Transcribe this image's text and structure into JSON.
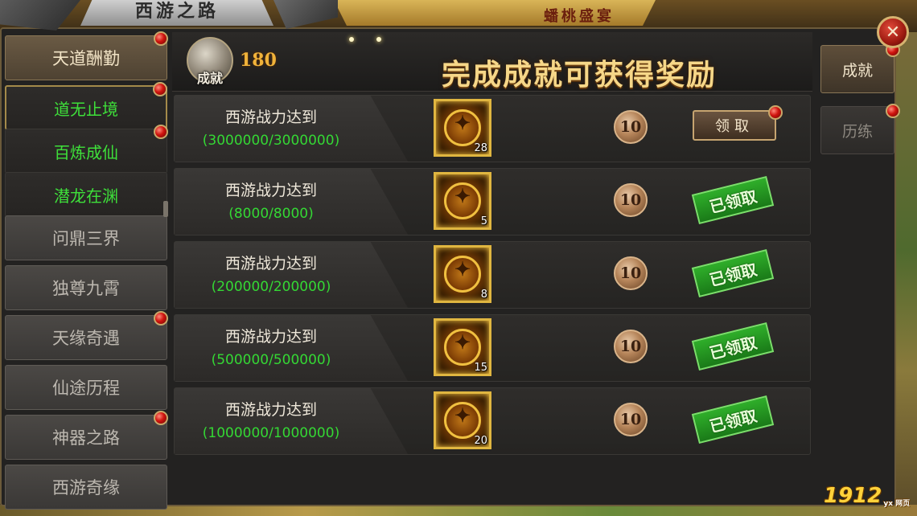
{
  "window": {
    "title": "西游之路",
    "top_banner": "蟠桃盛宴"
  },
  "menu": [
    {
      "label": "天道酬勤",
      "type": "head",
      "has_dot": true
    },
    {
      "label": "道无止境",
      "type": "sub",
      "active": true,
      "has_dot": true
    },
    {
      "label": "百炼成仙",
      "type": "sub",
      "has_dot": true
    },
    {
      "label": "潜龙在渊",
      "type": "sub",
      "has_dot": false
    },
    {
      "label": "问鼎三界",
      "type": "normal",
      "has_dot": false
    },
    {
      "label": "独尊九霄",
      "type": "normal",
      "has_dot": false
    },
    {
      "label": "天缘奇遇",
      "type": "normal",
      "has_dot": true
    },
    {
      "label": "仙途历程",
      "type": "normal",
      "has_dot": false
    },
    {
      "label": "神器之路",
      "type": "normal",
      "has_dot": true
    },
    {
      "label": "西游奇缘",
      "type": "normal",
      "has_dot": false
    }
  ],
  "header": {
    "badge_label": "成就",
    "score": "180",
    "headline": "完成成就可获得奖励"
  },
  "rows": [
    {
      "name": "西游战力达到",
      "progress": "(3000000/3000000)",
      "item_count": "28",
      "coin": "10",
      "status": "claim"
    },
    {
      "name": "西游战力达到",
      "progress": "(8000/8000)",
      "item_count": "5",
      "coin": "10",
      "status": "claimed"
    },
    {
      "name": "西游战力达到",
      "progress": "(200000/200000)",
      "item_count": "8",
      "coin": "10",
      "status": "claimed"
    },
    {
      "name": "西游战力达到",
      "progress": "(500000/500000)",
      "item_count": "15",
      "coin": "10",
      "status": "claimed"
    },
    {
      "name": "西游战力达到",
      "progress": "(1000000/1000000)",
      "item_count": "20",
      "coin": "10",
      "status": "claimed"
    }
  ],
  "buttons": {
    "claim_label": "领取",
    "claimed_label": "已领取"
  },
  "side_tabs": [
    {
      "label": "成就",
      "active": true,
      "has_dot": true
    },
    {
      "label": "历练",
      "active": false,
      "has_dot": true
    }
  ],
  "logo": {
    "text": "1912",
    "sub": "yx 网页游戏"
  },
  "colors": {
    "progress_green": "#34d834",
    "submenu_green": "#3ee03a",
    "headline_gold": "#f6d788",
    "score_gold": "#f0b23a"
  }
}
